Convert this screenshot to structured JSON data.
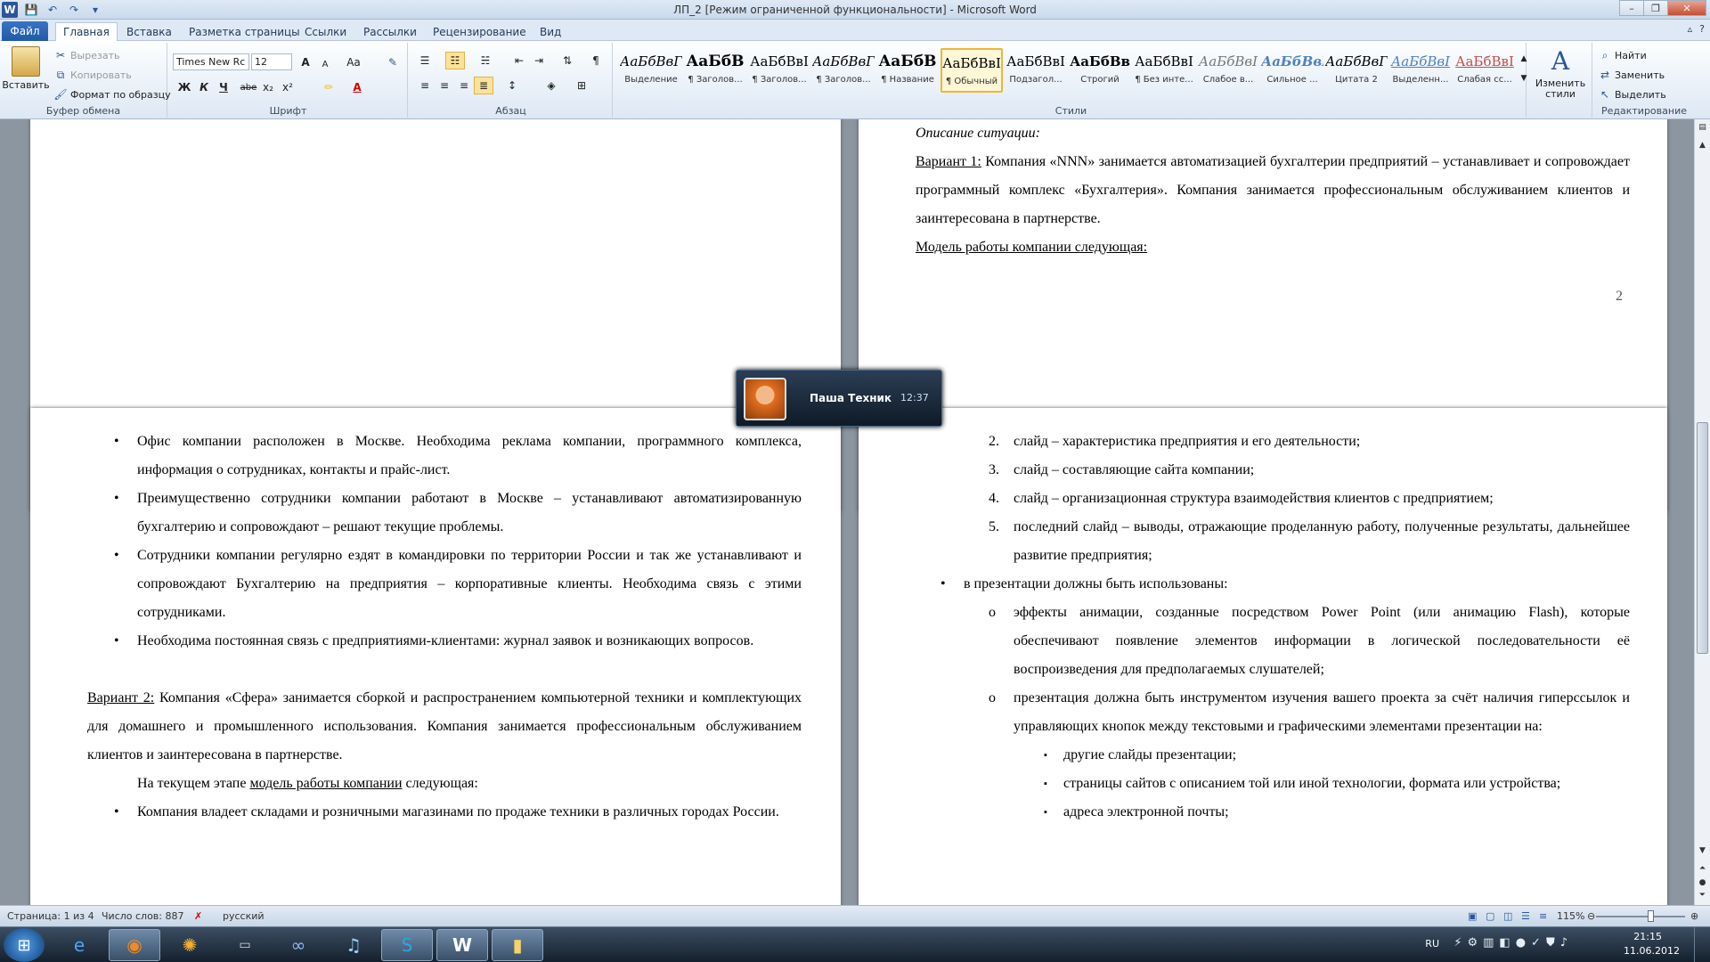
{
  "window": {
    "title": "ЛП_2 [Режим ограниченной функциональности] - Microsoft Word",
    "minimize": "–",
    "maximize": "❐",
    "close": "✕"
  },
  "quick_access": [
    "W",
    "💾",
    "↶",
    "↷",
    "▾"
  ],
  "tabs": [
    "Файл",
    "Главная",
    "Вставка",
    "Разметка страницы",
    "Ссылки",
    "Рассылки",
    "Рецензирование",
    "Вид"
  ],
  "tabs_right": [
    "▵",
    "?"
  ],
  "ribbon": {
    "clipboard": {
      "label": "Буфер обмена",
      "paste": "Вставить",
      "cut": "Вырезать",
      "copy": "Копировать",
      "format": "Формат по образцу"
    },
    "font": {
      "label": "Шрифт",
      "family": "Times New Rc",
      "size": "12",
      "bold": "Ж",
      "italic": "К",
      "underline": "Ч",
      "strike": "abe",
      "sub": "x₂",
      "sup": "x²",
      "case": "Аа",
      "grow": "A",
      "shrink": "A",
      "color": "A"
    },
    "paragraph": {
      "label": "Абзац"
    },
    "styles": {
      "label": "Стили",
      "items": [
        {
          "preview": "АаБбВвГ",
          "name": "Выделение"
        },
        {
          "preview": "АаБбВ",
          "name": "¶ Заголов..."
        },
        {
          "preview": "АаБбВвІ",
          "name": "¶ Заголов..."
        },
        {
          "preview": "АаБбВвГ",
          "name": "¶ Заголов..."
        },
        {
          "preview": "АаБбВ",
          "name": "¶ Название"
        },
        {
          "preview": "АаБбВвІ",
          "name": "¶ Обычный"
        },
        {
          "preview": "АаБбВвІ",
          "name": "Подзагол..."
        },
        {
          "preview": "АаБбВв",
          "name": "Строгий"
        },
        {
          "preview": "АаБбВвІ",
          "name": "¶ Без инте..."
        },
        {
          "preview": "АаБбВвІ",
          "name": "Слабое в..."
        },
        {
          "preview": "АаБбВвІ",
          "name": "Сильное ..."
        },
        {
          "preview": "АаБбВвГ",
          "name": "Цитата 2"
        },
        {
          "preview": "АаБбВвІ",
          "name": "Выделенн..."
        },
        {
          "preview": "АаБбВвІ",
          "name": "Слабая сс..."
        }
      ],
      "change": "Изменить стили"
    },
    "editing": {
      "label": "Редактирование",
      "find": "Найти",
      "replace": "Заменить",
      "select": "Выделить"
    }
  },
  "page_top_right": {
    "heading": "Описание ситуации:",
    "variant_label": "Вариант 1:",
    "variant_text": " Компания «NNN» занимается автоматизацией бухгалтерии предприятий – устанавливает и сопровождает программный комплекс «Бухгалтерия». Компания занимается профессиональным обслуживанием клиентов и заинтересована в партнерстве.",
    "model": "Модель работы компании следующая:",
    "page_number": "2"
  },
  "page_bottom_left": {
    "bullets": [
      "Офис компании расположен в Москве. Необходима реклама компании, программного комплекса, информация о сотрудниках, контакты и прайс-лист.",
      "Преимущественно сотрудники компании работают в Москве – устанавливают автоматизированную бухгалтерию и сопровождают – решают текущие проблемы.",
      "Сотрудники компании регулярно ездят в командировки по территории России и так же устанавливают и сопровождают Бухгалтерию на предприятия – корпоративные клиенты. Необходима связь с этими сотрудниками.",
      "Необходима постоянная связь с предприятиями-клиентами: журнал заявок и возникающих вопросов."
    ],
    "variant_label": "Вариант 2:",
    "variant_text": " Компания «Сфера» занимается сборкой и распространением компьютерной техники и комплектующих для домашнего и промышленного использования. Компания занимается профессиональным обслуживанием клиентов и заинтересована в партнерстве.",
    "stage_pre": "На текущем этапе ",
    "stage_link": "модель работы компании",
    "stage_post": " следующая:",
    "last_bullet": "Компания владеет складами и розничными магазинами по продаже техники в различных городах России."
  },
  "page_bottom_right": {
    "numbered": [
      {
        "n": "2.",
        "t": "слайд – характеристика предприятия и его деятельности;"
      },
      {
        "n": "3.",
        "t": "слайд – составляющие сайта компании;"
      },
      {
        "n": "4.",
        "t": "слайд – организационная структура взаимодействия клиентов с предприятием;"
      },
      {
        "n": "5.",
        "t": "последний слайд – выводы, отражающие проделанную работу, полученные результаты, дальнейшее развитие предприятия;"
      }
    ],
    "bullet": "в презентации должны быть использованы:",
    "sub1": "эффекты анимации, созданные посредством Power Point (или анимацию Flash), которые обеспечивают появление элементов информации в логической последовательности её воспроизведения для предполагаемых слушателей;",
    "sub2": "презентация должна быть инструментом изучения вашего проекта за счёт наличия гиперссылок и управляющих кнопок между текстовыми и графическими элементами презентации на:",
    "sub3": [
      "другие слайды презентации;",
      "страницы сайтов с описанием той или иной технологии, формата или устройства;",
      "адреса электронной почты;"
    ]
  },
  "notification": {
    "name": "Паша Техник",
    "time": "12:37"
  },
  "status": {
    "page": "Страница: 1 из 4",
    "words": "Число слов: 887",
    "lang": "русский",
    "zoom": "115%"
  },
  "tray": {
    "lang": "RU",
    "time": "21:15",
    "date": "11.06.2012"
  },
  "colors": {
    "accent": "#2b579a",
    "file_tab": "#1f5aa8"
  }
}
